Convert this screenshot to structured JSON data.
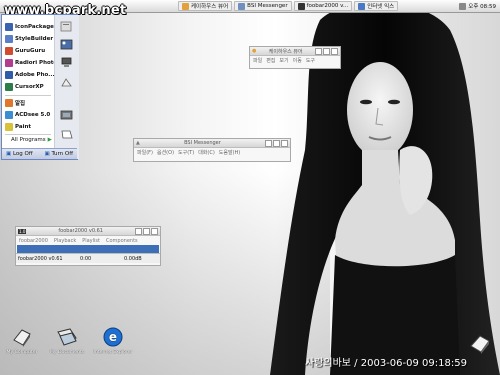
{
  "watermark": "www.bcpark.net",
  "taskbar": {
    "buttons": [
      {
        "label": "케이하우스 뷰어",
        "icon": "folder-icon",
        "color": "#e2a23b"
      },
      {
        "label": "BSI Messenger",
        "icon": "messenger-icon",
        "color": "#6f8fbf"
      },
      {
        "label": "foobar2000 v...",
        "icon": "foobar-icon",
        "color": "#333333"
      },
      {
        "label": "인터넷 익스",
        "icon": "browser-icon",
        "color": "#4a78c2"
      }
    ],
    "tray_text": "오후 08:59"
  },
  "start_menu": {
    "items": [
      {
        "label": "IconPackager",
        "icon": "iconpackager-icon",
        "color": "#3a63b0"
      },
      {
        "label": "StyleBuilder",
        "icon": "stylebuilder-icon",
        "color": "#5a7fc8"
      },
      {
        "label": "GuruGuru",
        "icon": "guruguru-icon",
        "color": "#d24a2f"
      },
      {
        "label": "Radiori Photo",
        "icon": "photo-icon",
        "color": "#b23c8f"
      },
      {
        "label": "Adobe Pho...",
        "icon": "adobe-photoshop-icon",
        "color": "#2f5da8"
      },
      {
        "label": "CursorXP",
        "icon": "cursor-icon",
        "color": "#2d7d4b"
      },
      {
        "label": "알집",
        "icon": "alzip-icon",
        "color": "#e0772b"
      },
      {
        "label": "ACDsee 5.0",
        "icon": "acdsee-icon",
        "color": "#3b8fd0"
      },
      {
        "label": "Paint",
        "icon": "paint-icon",
        "color": "#d9c13a"
      }
    ],
    "all_programs": "All Programs",
    "log_off": "Log Off",
    "turn_off": "Turn Off",
    "right_icons": [
      "documents-icon",
      "pictures-icon",
      "computer-icon",
      "network-icon",
      "control-panel-icon",
      "printer-icon"
    ]
  },
  "viewer_window": {
    "title": "케이하우스 뷰어",
    "menu": [
      "파일",
      "편집",
      "보기",
      "이동",
      "도구"
    ]
  },
  "messenger_window": {
    "title": "BSI Messenger",
    "menu": [
      "파일(F)",
      "옵션(O)",
      "도구(T)",
      "대화(C)",
      "도움말(H)"
    ]
  },
  "foobar_window": {
    "title": "foobar2000 v0.61",
    "menu": [
      "foobar2000",
      "Playback",
      "Playlist",
      "Components"
    ],
    "selected_row": "",
    "row": "foobar2000 v0.61",
    "status": [
      "foobar2000 v0.61",
      "0:00",
      "0.00dB"
    ]
  },
  "desktop_icons": [
    {
      "label": "My Computer",
      "icon": "my-computer-icon"
    },
    {
      "label": "My Documents",
      "icon": "my-documents-icon"
    },
    {
      "label": "Internet Explorer",
      "icon": "internet-explorer-icon"
    }
  ],
  "caption": "사랑의바보 / 2003-06-09 09:18:59"
}
